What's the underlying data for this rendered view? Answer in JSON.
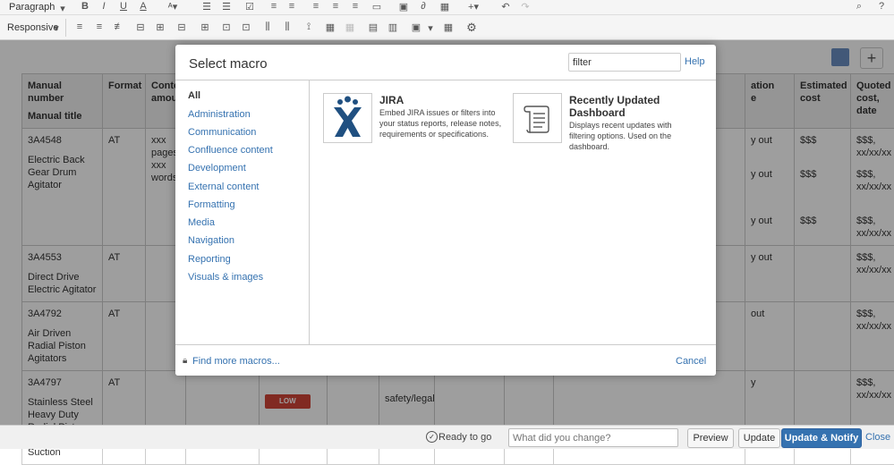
{
  "toolbar": {
    "paragraph": "Paragraph",
    "responsive": "Responsive",
    "help": "?"
  },
  "table": {
    "headers": [
      {
        "a": "Manual number",
        "b": "Manual title"
      },
      {
        "a": "Format",
        "b": ""
      },
      {
        "a": "Conte",
        "b": "amou"
      },
      {
        "a": "",
        "b": ""
      },
      {
        "a": "",
        "b": ""
      },
      {
        "a": "",
        "b": ""
      },
      {
        "a": "",
        "b": ""
      },
      {
        "a": "",
        "b": ""
      },
      {
        "a": "",
        "b": ""
      },
      {
        "a": "",
        "b": ""
      },
      {
        "a": "ation",
        "b": "e"
      },
      {
        "a": "Estimated",
        "b": "cost"
      },
      {
        "a": "Quoted",
        "b": "cost, date"
      }
    ],
    "rows": [
      {
        "number": "3A4548",
        "title": "Electric Back Gear Drum Agitator",
        "format": "AT",
        "content": "xxx pages xxx words",
        "status": "y out",
        "cost": "$$$",
        "quoted": "$$$, xx/xx/xx"
      },
      {
        "number": "3A4553",
        "title": "Direct Drive Electric Agitator",
        "format": "AT",
        "content": "",
        "status": "y out",
        "cost": "",
        "quoted": "$$$, xx/xx/xx"
      },
      {
        "number": "3A4792",
        "title": "Air Driven Radial Piston Agitators",
        "format": "AT",
        "content": "",
        "status": "out",
        "cost": "",
        "quoted": "$$$, xx/xx/xx"
      },
      {
        "number": "3A4797",
        "title": "Stainless Steel Heavy Duty Radial Piston Mixer with Suction",
        "format": "AT",
        "content": "",
        "status": "y",
        "cost": "",
        "quoted": "$$$, xx/xx/xx"
      }
    ],
    "extra_subrows": [
      {
        "status": "y out",
        "cost": "$$$",
        "quoted": "$$$, xx/xx/xx"
      },
      {
        "status": "y out",
        "cost": "$$$",
        "quoted": "$$$, xx/xx/xx"
      }
    ],
    "low_badge": "LOW",
    "safety_text": "safety/legal"
  },
  "dialog": {
    "title": "Select macro",
    "search_value": "filter",
    "help": "Help",
    "categories": [
      "All",
      "Administration",
      "Communication",
      "Confluence content",
      "Development",
      "External content",
      "Formatting",
      "Media",
      "Navigation",
      "Reporting",
      "Visuals & images"
    ],
    "macros": [
      {
        "name": "JIRA",
        "description": "Embed JIRA issues or filters into your status reports, release notes, requirements or specifications.",
        "icon": "jira-logo-icon"
      },
      {
        "name": "Recently Updated Dashboard",
        "description": "Displays recent updates with filtering options. Used on the dashboard.",
        "icon": "scroll-icon"
      }
    ],
    "find_more": "Find more macros...",
    "cancel": "Cancel"
  },
  "bottom": {
    "status": "Ready to go",
    "change_placeholder": "What did you change?",
    "preview": "Preview",
    "update": "Update",
    "update_notify": "Update & Notify",
    "close": "Close"
  },
  "colors": {
    "link": "#3572b0",
    "primary_button": "#3572b0",
    "low_badge": "#d04437",
    "jira_blue": "#205081"
  }
}
